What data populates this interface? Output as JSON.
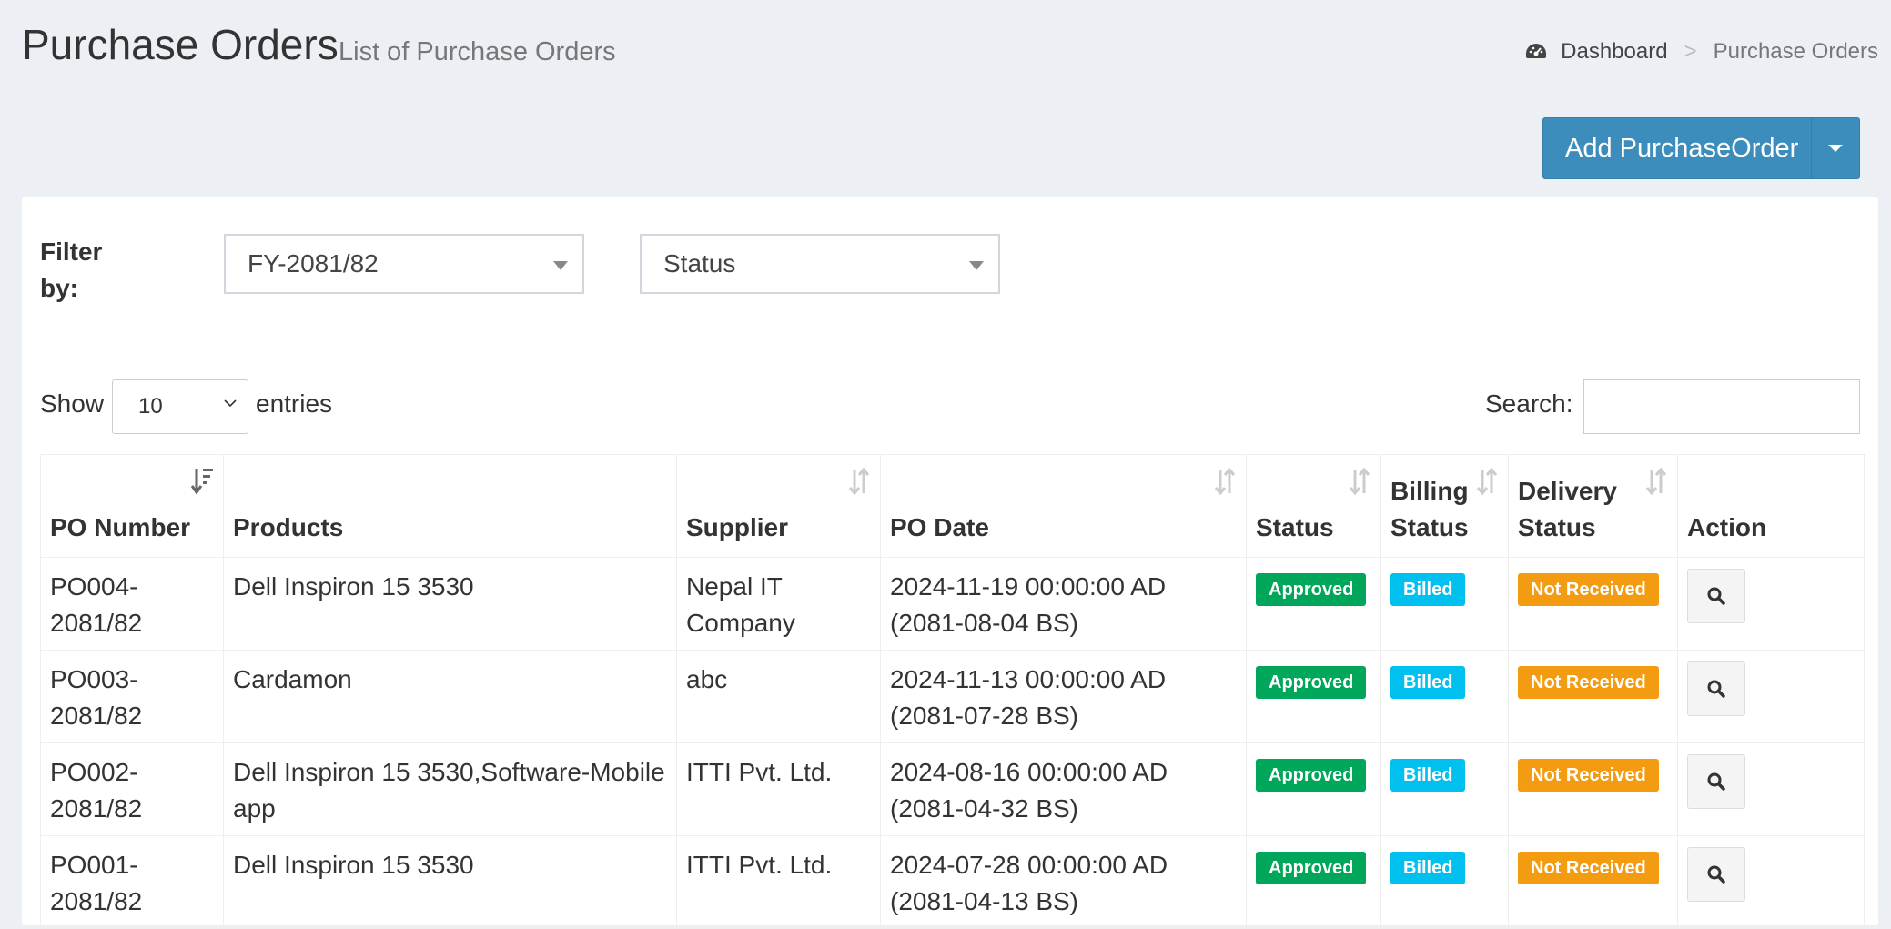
{
  "header": {
    "title": "Purchase Orders",
    "subtitle": "List of Purchase Orders",
    "breadcrumb": {
      "home": "Dashboard",
      "separator": ">",
      "current": "Purchase Orders"
    },
    "add_button_label": "Add PurchaseOrder"
  },
  "filters": {
    "label": "Filter by:",
    "fiscal_year": "FY-2081/82",
    "status": "Status"
  },
  "table_controls": {
    "show_label": "Show",
    "page_length": "10",
    "entries_label": "entries",
    "search_label": "Search:",
    "search_value": ""
  },
  "table": {
    "columns": [
      "PO Number",
      "Products",
      "Supplier",
      "PO Date",
      "Status",
      "Billing Status",
      "Delivery Status",
      "Action"
    ],
    "rows": [
      {
        "po_number": "PO004-2081/82",
        "products": "Dell Inspiron 15 3530",
        "supplier": "Nepal IT Company",
        "po_date": "2024-11-19 00:00:00 AD (2081-08-04 BS)",
        "status": "Approved",
        "billing": "Billed",
        "delivery": "Not Received"
      },
      {
        "po_number": "PO003-2081/82",
        "products": "Cardamon",
        "supplier": "abc",
        "po_date": "2024-11-13 00:00:00 AD (2081-07-28 BS)",
        "status": "Approved",
        "billing": "Billed",
        "delivery": "Not Received"
      },
      {
        "po_number": "PO002-2081/82",
        "products": "Dell Inspiron 15 3530,Software-Mobile app",
        "supplier": "ITTI Pvt. Ltd.",
        "po_date": "2024-08-16 00:00:00 AD (2081-04-32 BS)",
        "status": "Approved",
        "billing": "Billed",
        "delivery": "Not Received"
      },
      {
        "po_number": "PO001-2081/82",
        "products": "Dell Inspiron 15 3530",
        "supplier": "ITTI Pvt. Ltd.",
        "po_date": "2024-07-28 00:00:00 AD (2081-04-13 BS)",
        "status": "Approved",
        "billing": "Billed",
        "delivery": "Not Received"
      }
    ]
  },
  "colors": {
    "approved": "#00a65a",
    "billed": "#00c0ef",
    "not_received": "#f39c12",
    "primary": "#3c8dbc"
  }
}
